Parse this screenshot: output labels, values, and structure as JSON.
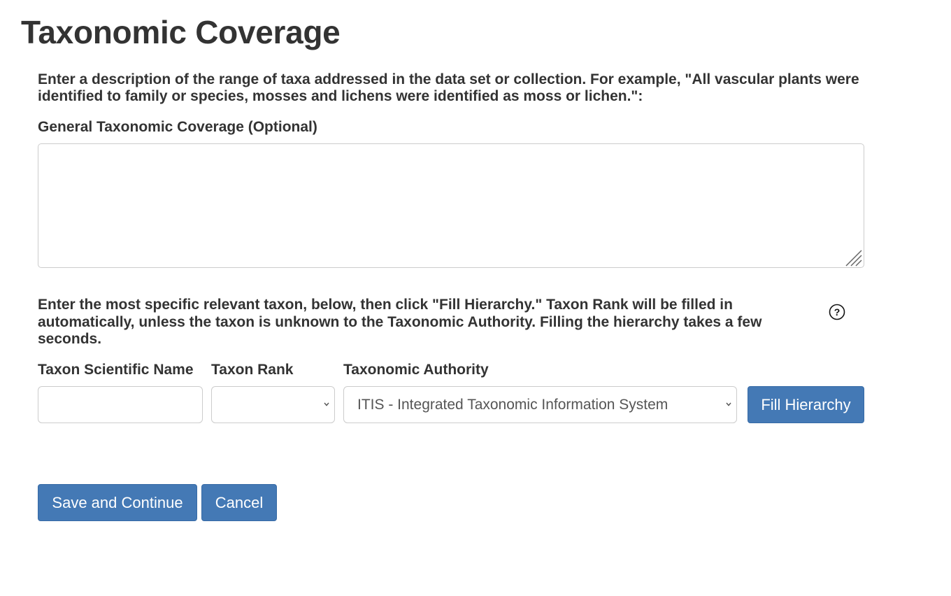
{
  "page": {
    "title": "Taxonomic Coverage"
  },
  "coverage": {
    "intro": "Enter a description of the range of taxa addressed in the data set or collection. For example, \"All vascular plants were identified to family or species, mosses and lichens were identified as moss or lichen.\":",
    "label": "General Taxonomic Coverage (Optional)",
    "value": ""
  },
  "taxon": {
    "hint": "Enter the most specific relevant taxon, below, then click \"Fill Hierarchy.\" Taxon Rank will be filled in automatically, unless the taxon is unknown to the Taxonomic Authority. Filling the hierarchy takes a few seconds.",
    "help_icon": "question-circle-icon",
    "name_label": "Taxon Scientific Name",
    "name_value": "",
    "rank_label": "Taxon Rank",
    "rank_value": "",
    "authority_label": "Taxonomic Authority",
    "authority_value": "ITIS - Integrated Taxonomic Information System",
    "fill_button": "Fill Hierarchy"
  },
  "actions": {
    "save_label": "Save and Continue",
    "cancel_label": "Cancel"
  },
  "colors": {
    "button_bg": "#4479b5",
    "text": "#333333",
    "border": "#cccccc"
  }
}
